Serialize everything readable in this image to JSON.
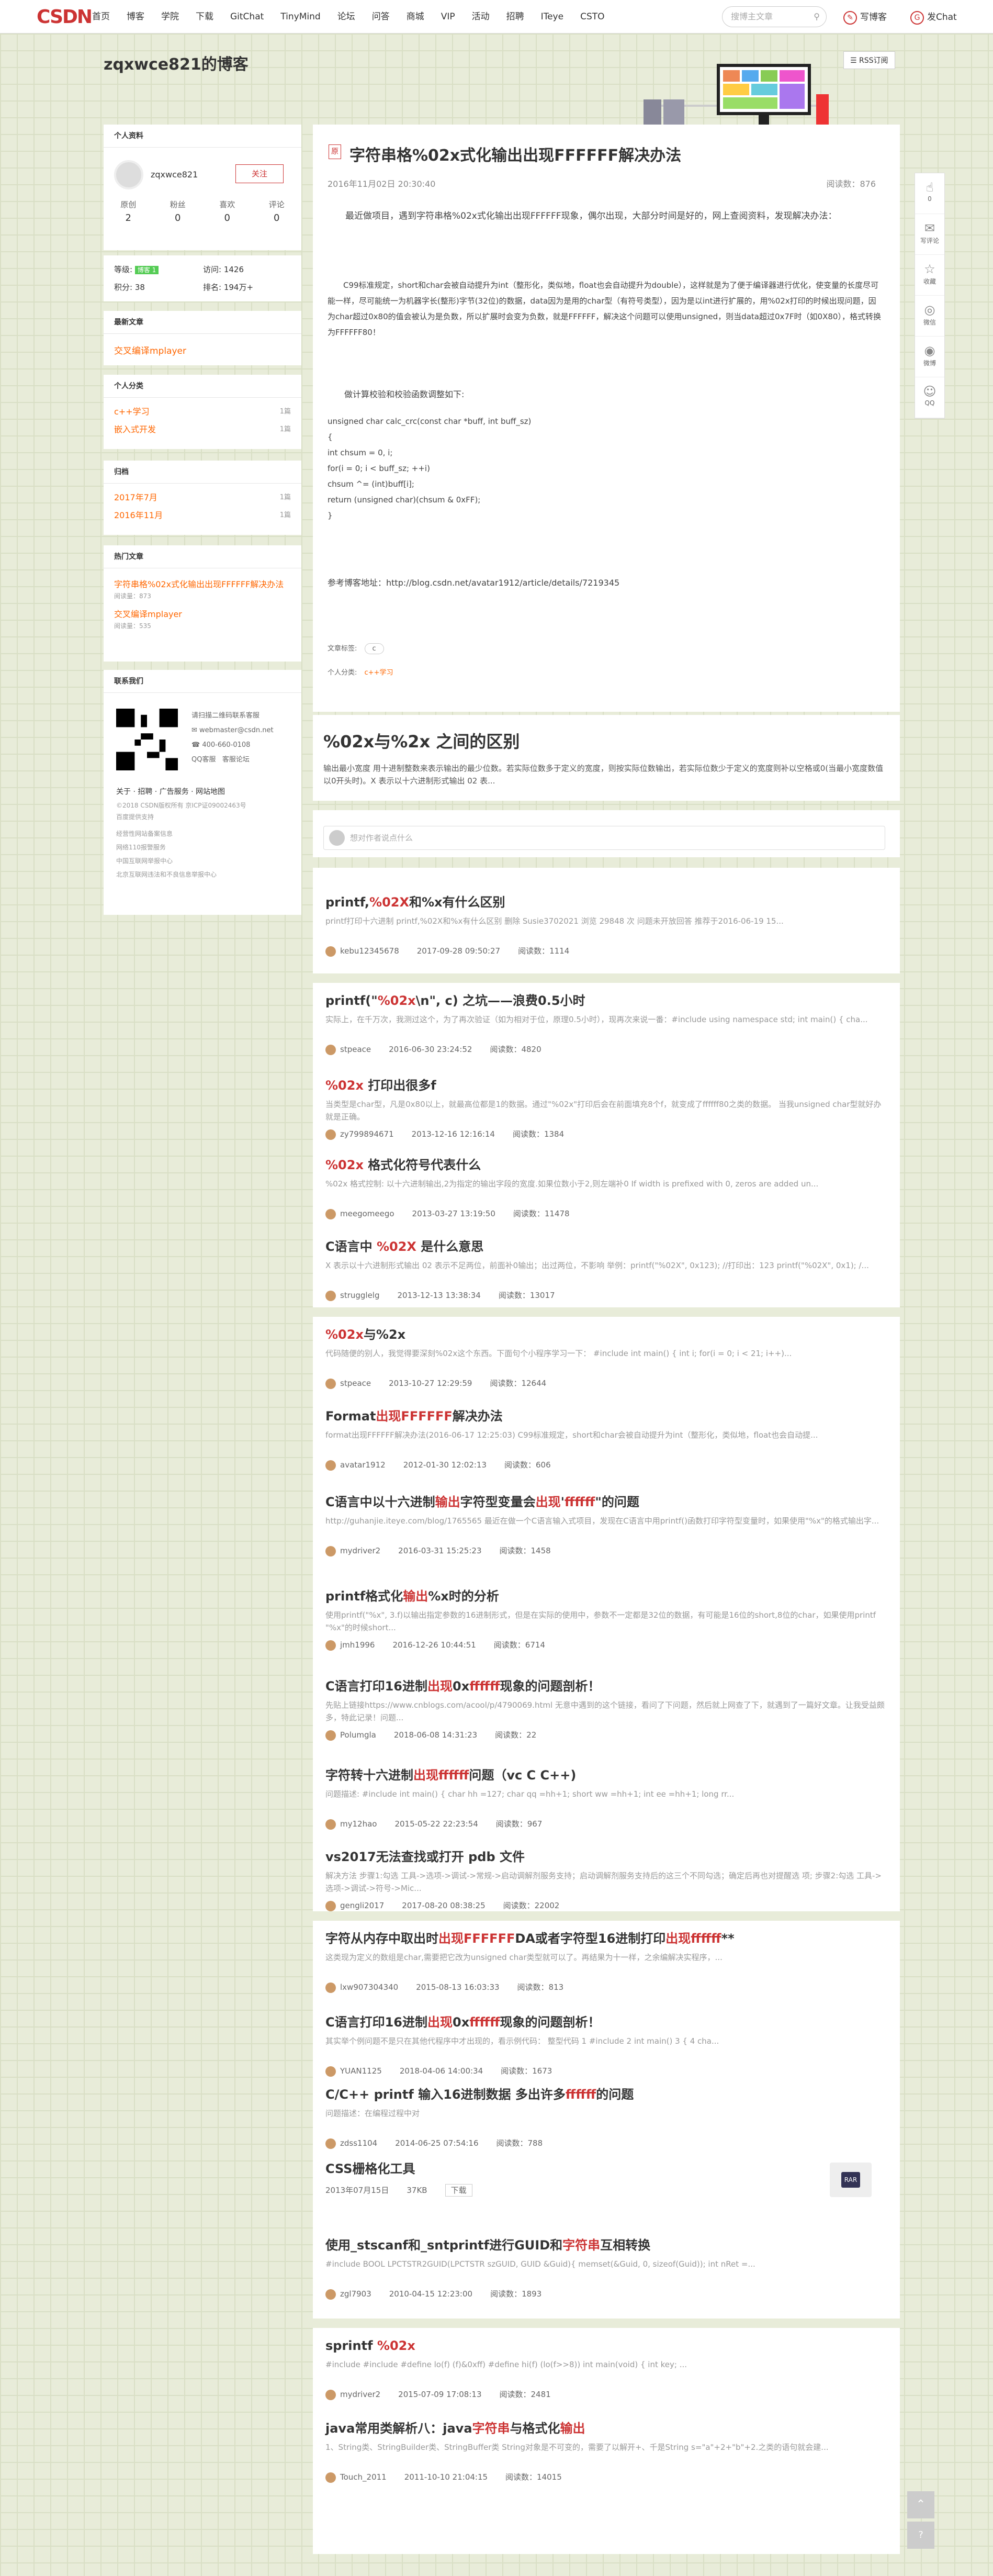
{
  "topbar": {
    "logo": "CSDN",
    "nav": [
      "首页",
      "博客",
      "学院",
      "下载",
      "GitChat",
      "TinyMind",
      "论坛",
      "问答",
      "商城",
      "VIP",
      "活动",
      "招聘",
      "ITeye",
      "CSTO"
    ],
    "search_placeholder": "搜博主文章",
    "write": "写博客",
    "message": "发Chat"
  },
  "blog_title": "zqxwce821的博客",
  "rss": "RSS订阅",
  "profile": {
    "header": "个人资料",
    "name": "zqxwce821",
    "follow": "关注",
    "stats": [
      {
        "label": "原创",
        "value": "2"
      },
      {
        "label": "粉丝",
        "value": "0"
      },
      {
        "label": "喜欢",
        "value": "0"
      },
      {
        "label": "评论",
        "value": "0"
      }
    ],
    "level_label": "等级:",
    "level": "博客 1",
    "visits_label": "访问:",
    "visits": "1426",
    "points_label": "积分:",
    "points": "38",
    "rank_label": "排名:",
    "rank": "194万+"
  },
  "latest": {
    "header": "最新文章",
    "items": [
      "交叉编译mplayer"
    ]
  },
  "categories": {
    "header": "个人分类",
    "items": [
      {
        "name": "c++学习",
        "count": "1篇"
      },
      {
        "name": "嵌入式开发",
        "count": "1篇"
      }
    ]
  },
  "archive": {
    "header": "归档",
    "items": [
      {
        "name": "2017年7月",
        "count": "1篇"
      },
      {
        "name": "2016年11月",
        "count": "1篇"
      }
    ]
  },
  "hot": {
    "header": "热门文章",
    "items": [
      {
        "title": "字符串格%02x式化输出出现FFFFFF解决办法",
        "reads": "阅读量：873"
      },
      {
        "title": "交叉编译mplayer",
        "reads": "阅读量：535"
      }
    ]
  },
  "contact": {
    "header": "联系我们",
    "scan": "请扫描二维码联系客服",
    "email": "webmaster@csdn.net",
    "phone": "400-660-0108",
    "qq": "QQ客服",
    "service": "客服论坛",
    "links": "关于 · 招聘 · 广告服务 · 网站地图",
    "copyright": "©2018 CSDN版权所有 京ICP证09002463号",
    "baidu": "百度提供支持",
    "legal": [
      "经营性网站备案信息",
      "网络110报警服务",
      "中国互联网举报中心",
      "北京互联网违法和不良信息举报中心"
    ]
  },
  "article": {
    "title": "字符串格%02x式化输出出现FFFFFF解决办法",
    "date": "2016年11月02日 20:30:40",
    "reads": "阅读数：876",
    "p1": "最近做项目，遇到字符串格%02x式化输出出现FFFFFF现象，偶尔出现，大部分时间是好的，网上查阅资料，发现解决办法：",
    "p2": "C99标准规定，short和char会被自动提升为int（整形化，类似地，float也会自动提升为double），这样就是为了便于编译器进行优化，使变量的长度尽可能一样，尽可能统一为机器字长(整形)字节(32位)的数据，data因为是用的char型（有符号类型），因为是以int进行扩展的，用%02x打印的时候出现问题，因为char超过0x80的值会被认为是负数，所以扩展时会变为负数，就是FFFFFF，解决这个问题可以使用unsigned，则当data超过0x7F时（如0X80），格式转换为FFFFFF80！",
    "p3": "做计算校验和校验函数调整如下:",
    "code": [
      "unsigned char calc_crc(const char *buff, int buff_sz)",
      "{",
      "int chsum = 0, i;",
      "for(i = 0; i < buff_sz; ++i)",
      "chsum ^= (int)buff[i];",
      "return (unsigned char)(chsum & 0xFF);",
      "}"
    ],
    "ref": "参考博客地址：http://blog.csdn.net/avatar1912/article/details/7219345",
    "tag_label": "文章标签:",
    "tag": "c",
    "cat_label": "个人分类:",
    "cat": "c++学习"
  },
  "recommend": {
    "title": "%02x与%2x 之间的区别",
    "desc": "输出最小宽度 用十进制整数来表示输出的最少位数。若实际位数多于定义的宽度，则按实际位数输出，若实际位数少于定义的宽度则补以空格或0(当最小宽度数值以0开头时)。X 表示以十六进制形式输出 02 表..."
  },
  "comment_placeholder": "想对作者说点什么",
  "list": [
    {
      "title": "printf,%02X和%x有什么区别",
      "desc": "printf打印十六进制 printf,%02X和%x有什么区别 删除 Susie3702021 浏览 29848 次 问题未开放回答 推荐于2016-06-19 15...",
      "user": "kebu12345678",
      "date": "2017-09-28 09:50:27",
      "reads": "阅读数：1114"
    },
    {
      "title": "printf(\"%02x\\n\", c) 之坑——浪费0.5小时",
      "desc": "实际上，在千万次，我测过这个，为了再次验证（如为相对于位，原理0.5小时），现再次来说一番：#include using namespace std; int main() { cha...",
      "user": "stpeace",
      "date": "2016-06-30 23:24:52",
      "reads": "阅读数：4820"
    },
    {
      "title": "%02x 打印出很多f",
      "desc": "当类型是char型，凡是0x80以上，就最高位都是1的数据。通过\"%02x\"打印后会在前面填充8个f，就变成了ffffff80之类的数据。  当我unsigned char型就好办就是正确。",
      "user": "zy799894671",
      "date": "2013-12-16 12:16:14",
      "reads": "阅读数：1384"
    },
    {
      "title": "%02x 格式化符号代表什么",
      "desc": "%02x  格式控制: 以十六进制输出,2为指定的输出字段的宽度.如果位数小于2,则左端补0 If width is prefixed with 0, zeros are added un...",
      "user": "meegomeego",
      "date": "2013-03-27 13:19:50",
      "reads": "阅读数：11478"
    },
    {
      "title": "C语言中 %02X 是什么意思",
      "desc": "X 表示以十六进制形式输出 02 表示不足两位，前面补0输出；出过两位，不影响 举例：printf(\"%02X\", 0x123); //打印出：123 printf(\"%02X\", 0x1); /...",
      "user": "strugglelg",
      "date": "2013-12-13 13:38:34",
      "reads": "阅读数：13017"
    },
    {
      "title": "%02x与%2x",
      "desc": "代码随便的别人，我觉得要深刻%02x这个东西。下面句个小程序学习一下：  #include int main() { int i; for(i = 0; i < 21; i++)...",
      "user": "stpeace",
      "date": "2013-10-27 12:29:59",
      "reads": "阅读数：12644"
    },
    {
      "title": "Format出现FFFFFF解决办法",
      "desc": "format出现FFFFFF解决办法(2016-06-17 12:25:03)    C99标准规定，short和char会被自动提升为int（整形化，类似地，float也会自动提...",
      "user": "avatar1912",
      "date": "2012-01-30 12:02:13",
      "reads": "阅读数：606"
    },
    {
      "title": "C语言中以十六进制输出字符型变量会出现'ffffff\"的问题",
      "desc": "http://guhanjie.iteye.com/blog/1765565 最近在做一个C语言输入式项目，发现在C语言中用printf()函数打印字符型变量时，如果使用\"%x\"的格式输出字...",
      "user": "mydriver2",
      "date": "2016-03-31 15:25:23",
      "reads": "阅读数：1458"
    },
    {
      "title": "printf格式化输出%x时的分析",
      "desc": "使用printf(\"%x\", 3.f)以输出指定参数的16进制形式，但是在实际的使用中，参数不一定都是32位的数据，有可能是16位的short,8位的char，如果使用printf \"%x\"的时候short...",
      "user": "jmh1996",
      "date": "2016-12-26 10:44:51",
      "reads": "阅读数：6714"
    },
    {
      "title": "C语言打印16进制出现0xffffff现象的问题剖析！",
      "desc": "先贴上链接https://www.cnblogs.com/acool/p/4790069.html 无意中遇到的这个链接，看问了下问题，然后就上网查了下，就遇到了一篇好文章。让我受益颇多，特此记录！问题...",
      "user": "Polumgla",
      "date": "2018-06-08 14:31:23",
      "reads": "阅读数：22"
    },
    {
      "title": "字符转十六进制出现ffffff问题（vc C C++)",
      "desc": "问题描述: #include int main() { char hh =127; char qq =hh+1; short ww =hh+1; int ee =hh+1; long rr...",
      "user": "my12hao",
      "date": "2015-05-22 22:23:54",
      "reads": "阅读数：967"
    },
    {
      "title": "vs2017无法查找或打开 pdb 文件",
      "desc": "解决方法 步骤1:勾选 工具->选项->调试->常规->启动调解剂服务支持；启动调解剂服务支持后的这三个不同勾选；确定后再也对提醒选 项; 步骤2:勾选 工具->选项->调试->符号->Mic...",
      "user": "gengli2017",
      "date": "2017-08-20 08:38:25",
      "reads": "阅读数：22002"
    },
    {
      "title": "字符从内存中取出时出现FFFFFFDA或者字符型16进制打印出现ffffff**",
      "desc": "这类现为定义的数组是char,需要把它改为unsigned char类型就可以了。再结果为十一样，之余编解决实程序，...",
      "user": "lxw907304340",
      "date": "2015-08-13 16:03:33",
      "reads": "阅读数：813"
    },
    {
      "title": "C语言打印16进制出现0xffffff现象的问题剖析！",
      "desc": "其实举个例问题不是只在其他代程序中才出现的，看示例代码：  整型代码 1 #include  2 int main()  3 {  4    cha...",
      "user": "YUAN1125",
      "date": "2018-04-06 14:00:34",
      "reads": "阅读数：1673"
    },
    {
      "title": "C/C++ printf 输入16进制数据 多出许多ffffff的问题",
      "desc": "问题描述：在编程过程中对",
      "user": "zdss1104",
      "date": "2014-06-25 07:54:16",
      "reads": "阅读数：788"
    },
    {
      "title": "CSS栅格化工具",
      "date": "2013年07月15日",
      "size": "37KB",
      "download": "下载",
      "badge": "RAR"
    },
    {
      "title": "使用_stscanf和_sntprintf进行GUID和字符串互相转换",
      "desc": "#include BOOL LPCTSTR2GUID(LPCTSTR szGUID, GUID &Guid){ memset(&Guid, 0, sizeof(Guid)); int nRet =...",
      "user": "zgl7903",
      "date": "2010-04-15 12:23:00",
      "reads": "阅读数：1893"
    },
    {
      "title": "sprintf %02x",
      "desc": "#include #include #define lo(f) (f)&0xff) #define hi(f) (lo(f>>8)) int main(void) { int key; ...",
      "user": "mydriver2",
      "date": "2015-07-09 17:08:13",
      "reads": "阅读数：2481"
    },
    {
      "title": "java常用类解析八：java字符串与格式化输出",
      "desc": "1、String类、StringBuilder类、StringBuffer类    String对象是不可变的，需要了以解开+、千是String s=\"a\"+2+\"b\"+2.之类的语句就会建...",
      "user": "Touch_2011",
      "date": "2011-10-10 21:04:15",
      "reads": "阅读数：14015"
    }
  ],
  "float": [
    {
      "icon": "thumb-up",
      "label": "0"
    },
    {
      "icon": "comment",
      "label": "写评论"
    },
    {
      "icon": "bookmark",
      "label": "收藏"
    },
    {
      "icon": "wechat",
      "label": "微信"
    },
    {
      "icon": "weibo",
      "label": "微博"
    },
    {
      "icon": "qq",
      "label": "QQ"
    }
  ],
  "colors": {
    "accent": "#ca0c16",
    "bg": "#e8ecd9",
    "orange": "#f60"
  }
}
